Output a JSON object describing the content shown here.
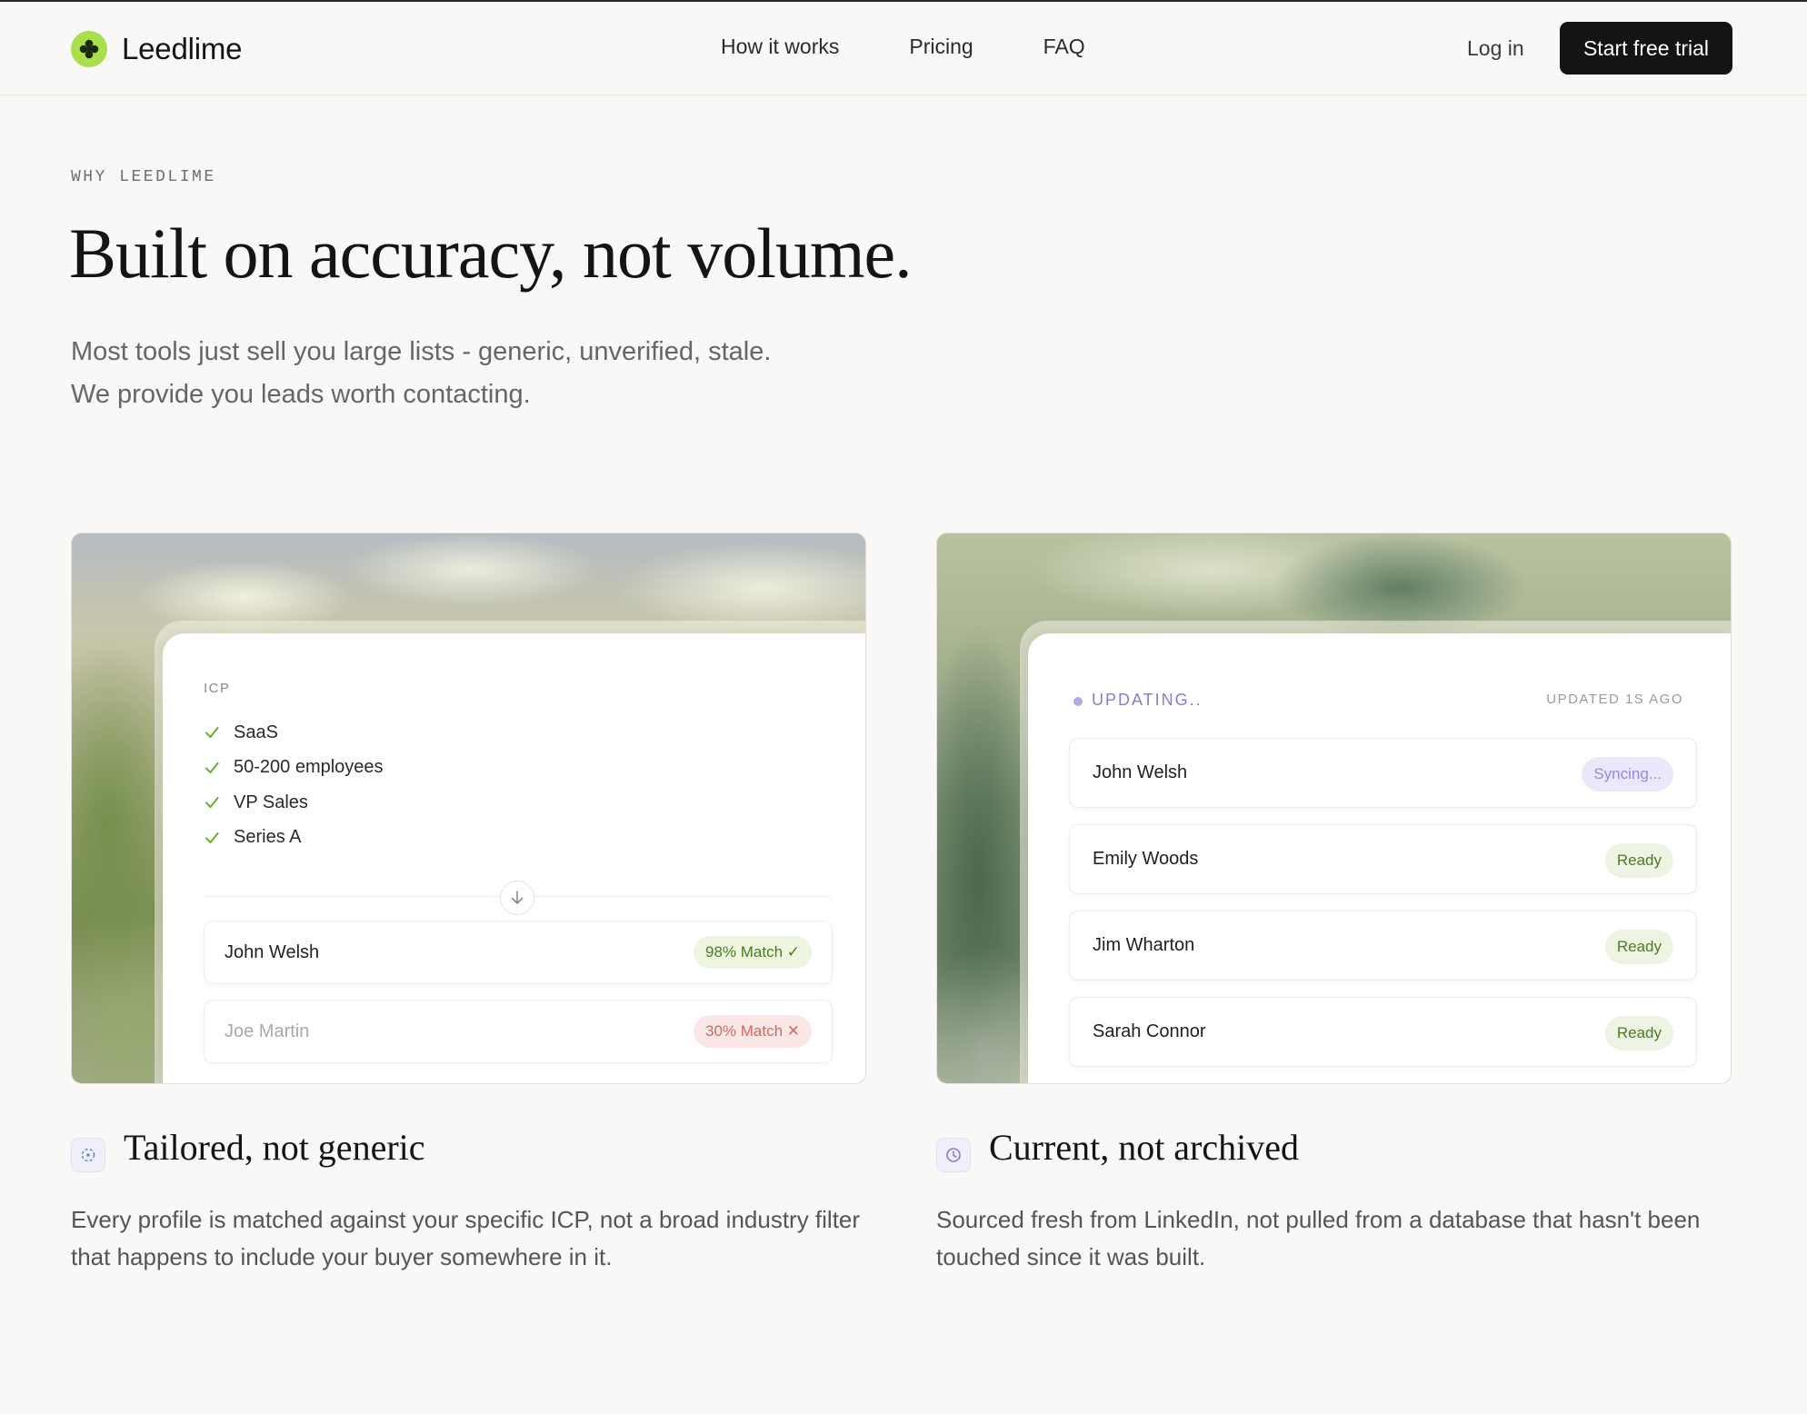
{
  "nav": {
    "brand": "Leedlime",
    "links": [
      "How it works",
      "Pricing",
      "FAQ"
    ],
    "login": "Log in",
    "cta": "Start free trial"
  },
  "hero": {
    "eyebrow": "WHY LEEDLIME",
    "headline": "Built on accuracy, not volume.",
    "sub_line1": "Most tools just sell you large lists - generic, unverified, stale.",
    "sub_line2": "We provide you leads worth contacting."
  },
  "left_card": {
    "label": "ICP",
    "criteria": [
      "SaaS",
      "50-200 employees",
      "VP Sales",
      "Series A"
    ],
    "matches": [
      {
        "name": "John Welsh",
        "badge": "98% Match ✓"
      },
      {
        "name": "Joe Martin",
        "badge": "30% Match ✕"
      }
    ]
  },
  "right_card": {
    "status": "UPDATING..",
    "updated": "UPDATED 1S AGO",
    "rows": [
      {
        "name": "John Welsh",
        "state": "Syncing..."
      },
      {
        "name": "Emily Woods",
        "state": "Ready"
      },
      {
        "name": "Jim Wharton",
        "state": "Ready"
      },
      {
        "name": "Sarah Connor",
        "state": "Ready"
      }
    ]
  },
  "features": [
    {
      "title": "Tailored, not generic",
      "body": "Every profile is matched against your specific ICP, not a broad industry filter that happens to include your buyer somewhere in it.",
      "icon": "target-icon"
    },
    {
      "title": "Current, not archived",
      "body": "Sourced fresh from LinkedIn, not pulled from a database that hasn't been touched since it was built.",
      "icon": "clock-icon"
    }
  ],
  "colors": {
    "accent_lime": "#a8df4a",
    "cta_black": "#141414",
    "match_green": "#4a7c1f",
    "match_red": "#cc6a62",
    "sync_purple": "#8c7ad1"
  }
}
